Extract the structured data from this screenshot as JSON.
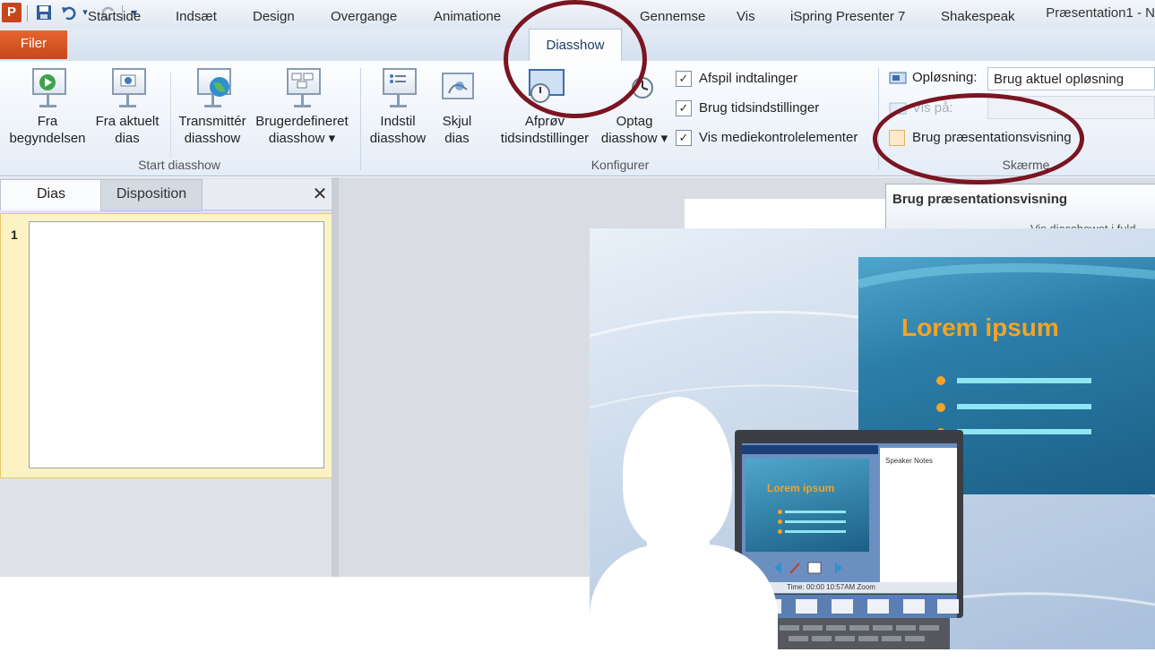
{
  "app": {
    "icon_letter": "P",
    "title": "Præsentation1 - N"
  },
  "quick_access": {
    "save_icon": "save-icon",
    "undo_icon": "undo-icon",
    "undo_dropdown": "▾",
    "redo_icon": "redo-icon",
    "customize": "▾"
  },
  "tabs": {
    "file": "Filer",
    "items": [
      "Startside",
      "Indsæt",
      "Design",
      "Overgange",
      "Animatione",
      "Diasshow",
      "Gennemse",
      "Vis",
      "iSpring Presenter 7",
      "Shakespeak"
    ],
    "active": "Diasshow"
  },
  "ribbon": {
    "start_group": {
      "label": "Start diasshow",
      "buttons": [
        {
          "line1": "Fra",
          "line2": "begyndelsen"
        },
        {
          "line1": "Fra aktuelt",
          "line2": "dias"
        },
        {
          "line1": "Transmittér",
          "line2": "diasshow"
        },
        {
          "line1": "Brugerdefineret",
          "line2": "diasshow ▾"
        }
      ]
    },
    "config_group": {
      "label": "Konfigurer",
      "buttons": [
        {
          "line1": "Indstil",
          "line2": "diasshow"
        },
        {
          "line1": "Skjul",
          "line2": "dias"
        },
        {
          "line1": "Afprøv",
          "line2": "tidsindstillinger"
        },
        {
          "line1": "Optag",
          "line2": "diasshow ▾"
        }
      ],
      "checkboxes": [
        {
          "label": "Afspil indtalinger",
          "checked": true
        },
        {
          "label": "Brug tidsindstillinger",
          "checked": true
        },
        {
          "label": "Vis mediekontrolelementer",
          "checked": true
        }
      ]
    },
    "screens_group": {
      "label": "Skærme",
      "resolution_label": "Opløsning:",
      "resolution_value": "Brug aktuel opløsning",
      "show_on_label": "Vis på:",
      "presenter_view_label": "Brug præsentationsvisning",
      "presenter_view_checked": false
    }
  },
  "left_panel": {
    "tab_slides": "Dias",
    "tab_outline": "Disposition",
    "close": "✕",
    "slide_number": "1"
  },
  "tooltip": {
    "title": "Brug præsentationsvisning",
    "text": "Vis diasshowet i fuld"
  },
  "illustration": {
    "slide_title": "Lorem ipsum",
    "small_slide_title": "Lorem ipsum",
    "notes_label": "Speaker Notes",
    "status_text": "Time: 00:00  10:57AM  Zoom"
  },
  "colors": {
    "accent_file_tab": "#d4541f",
    "highlight_ring": "#7a1521",
    "slide_title": "#f4a325"
  }
}
